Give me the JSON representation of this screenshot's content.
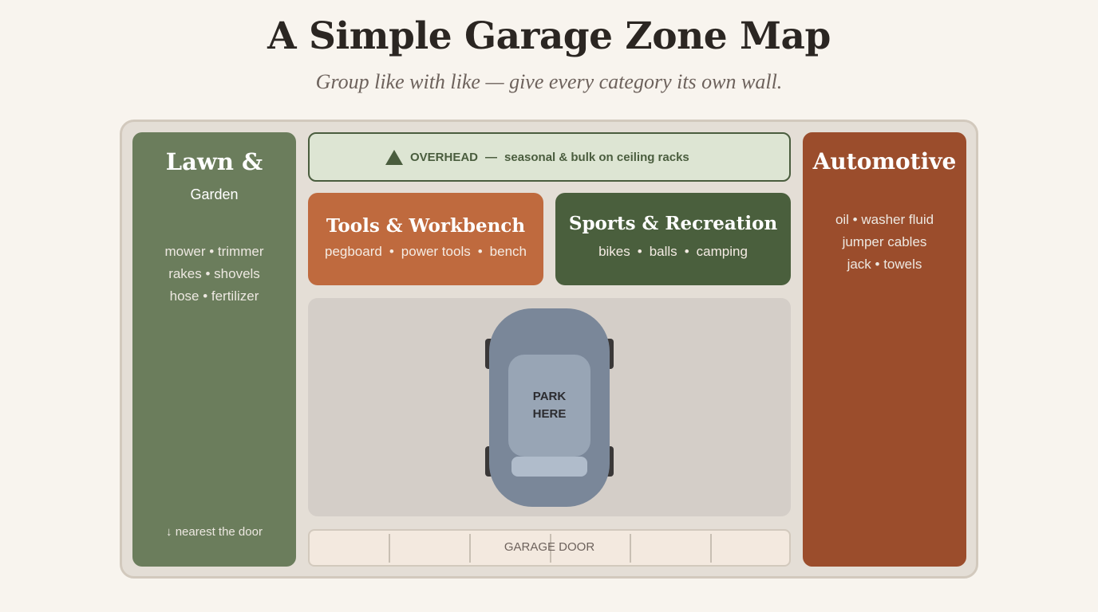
{
  "header": {
    "title": "A Simple Garage Zone Map",
    "subtitle": "Group like with like — give every category its own wall."
  },
  "lawn": {
    "title": "Lawn &",
    "subtitle": "Garden",
    "items": [
      "mower • trimmer",
      "rakes • shovels",
      "hose • fertilizer"
    ],
    "door_note": "↓ nearest the door",
    "color": "#6b7d5c"
  },
  "overhead": {
    "icon": "triangle-up-icon",
    "label": "OVERHEAD",
    "separator": "—",
    "description": "seasonal & bulk on ceiling racks",
    "color": "#dde5d3"
  },
  "tools": {
    "title": "Tools & Workbench",
    "items": [
      "pegboard",
      "power tools",
      "bench"
    ],
    "color": "#bf6a3e"
  },
  "sports": {
    "title": "Sports & Recreation",
    "items": [
      "bikes",
      "balls",
      "camping"
    ],
    "color": "#4a5f3d"
  },
  "parking": {
    "label_line1": "PARK",
    "label_line2": "HERE",
    "icon": "car-top-view-icon"
  },
  "garage_door": {
    "label": "GARAGE DOOR"
  },
  "automotive": {
    "title": "Automotive",
    "items": [
      "oil • washer fluid",
      "jumper cables",
      "jack • towels"
    ],
    "color": "#9b4d2c"
  }
}
